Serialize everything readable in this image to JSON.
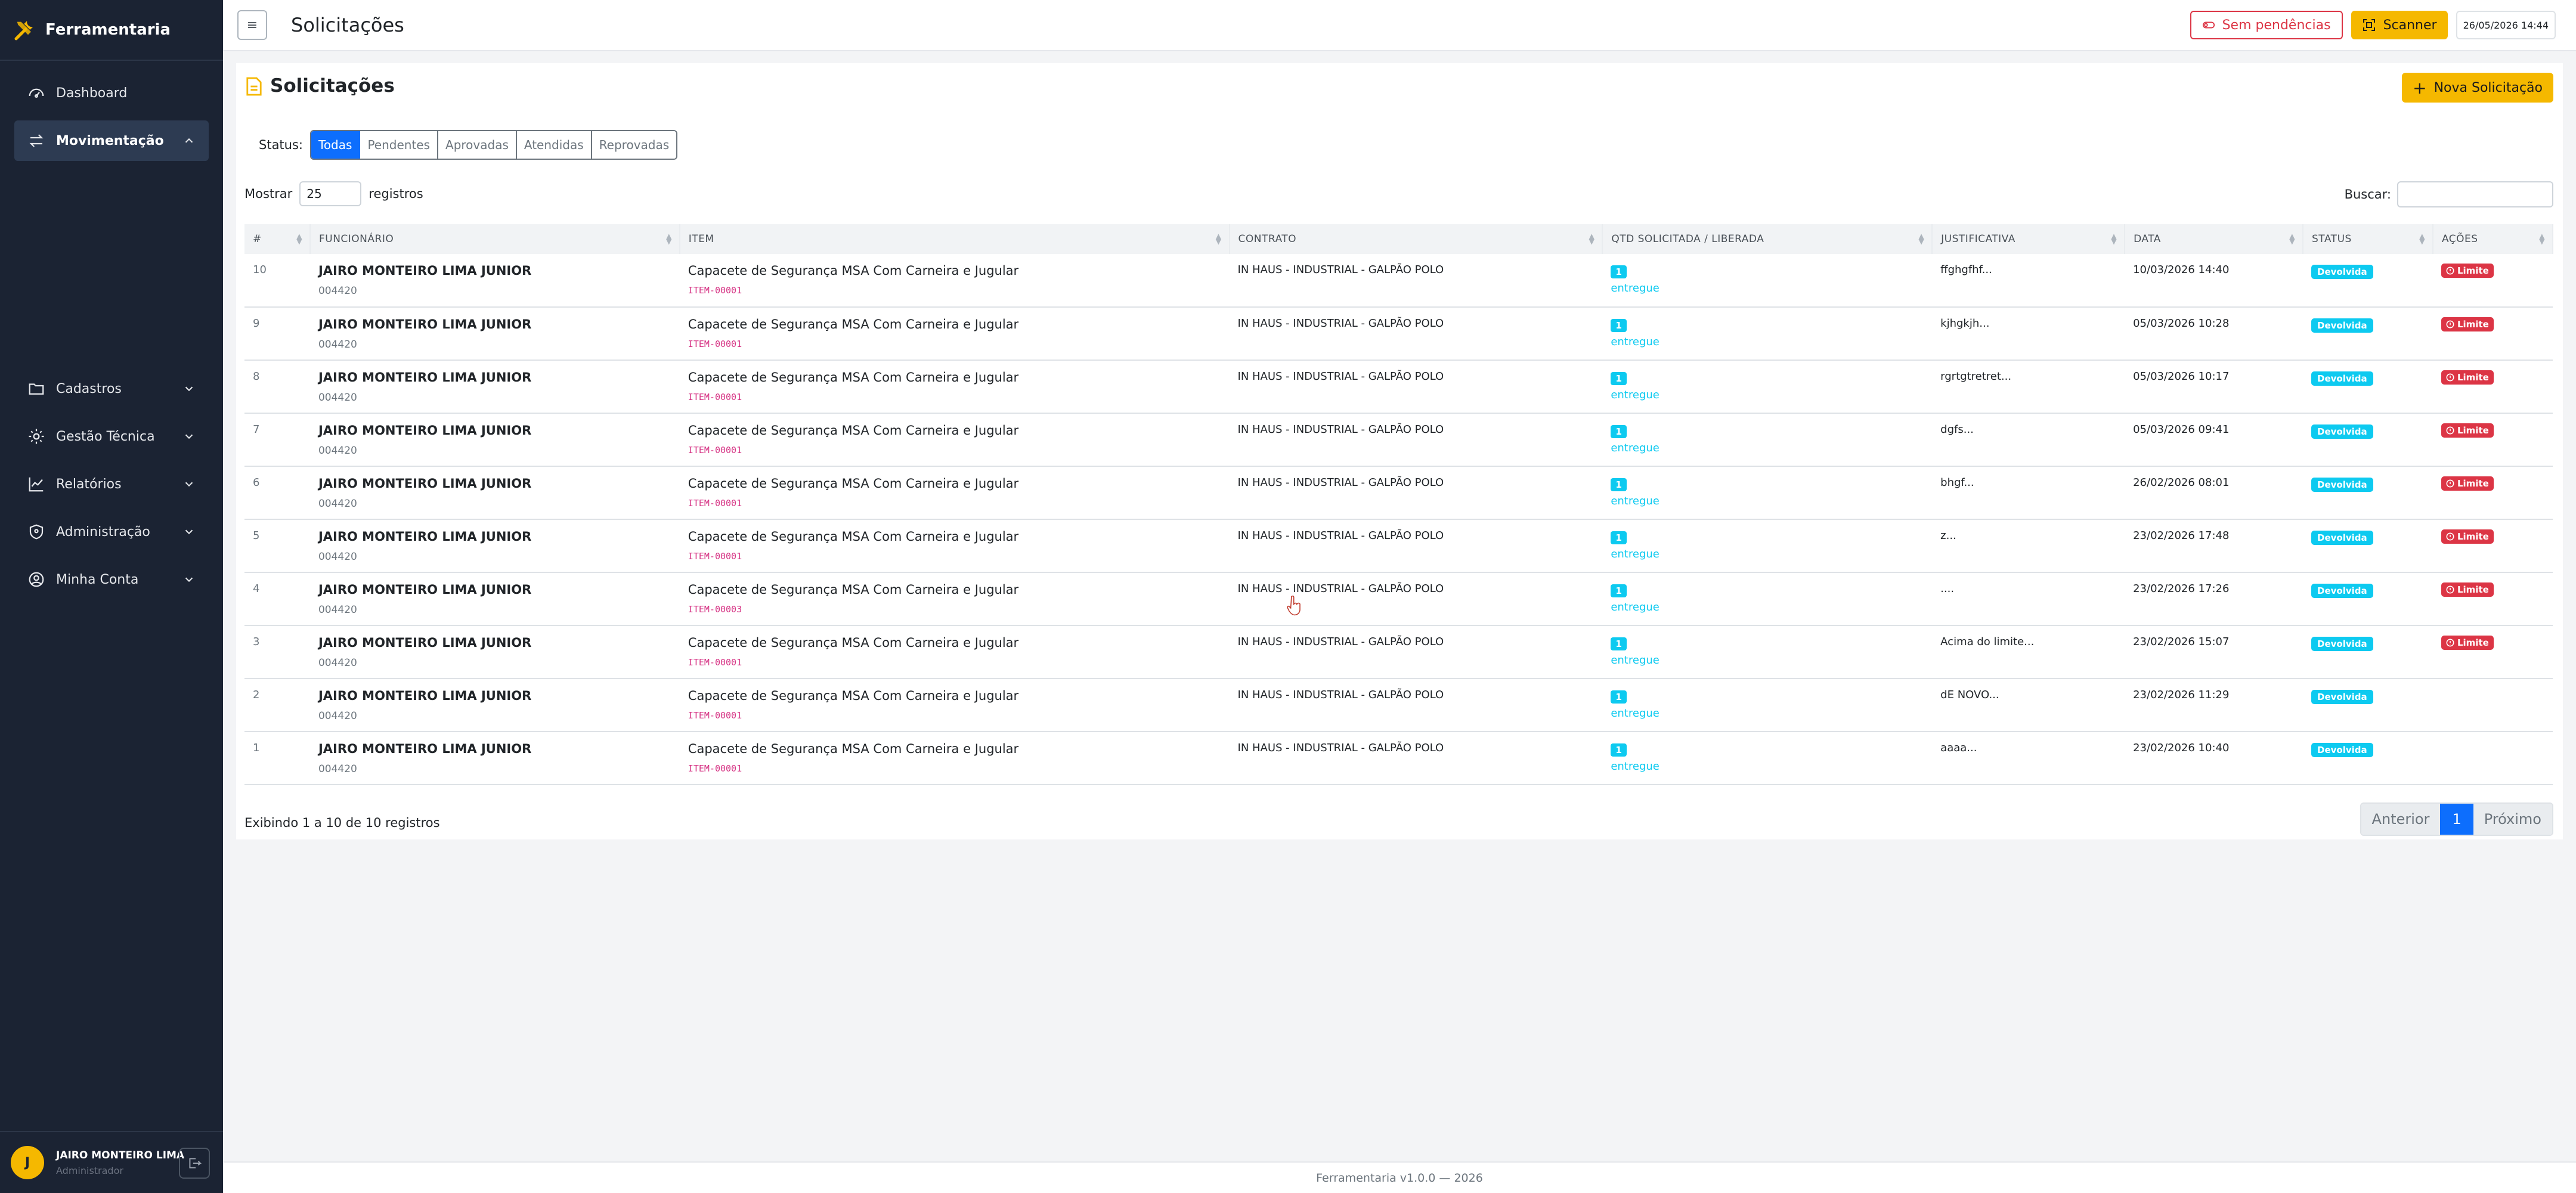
{
  "app": {
    "name": "Ferramentaria"
  },
  "sidebar": {
    "items": [
      {
        "label": "Dashboard",
        "icon": "gauge-icon"
      },
      {
        "label": "Movimentação",
        "icon": "arrows-exchange-icon",
        "active": true
      }
    ],
    "groups": [
      {
        "label": "Cadastros",
        "icon": "folder-icon"
      },
      {
        "label": "Gestão Técnica",
        "icon": "gear-icon"
      },
      {
        "label": "Relatórios",
        "icon": "chart-line-icon"
      },
      {
        "label": "Administração",
        "icon": "shield-icon"
      },
      {
        "label": "Minha Conta",
        "icon": "user-circle-icon"
      }
    ],
    "user": {
      "initial": "J",
      "name": "JAIRO MONTEIRO LIMA",
      "role": "Administrador"
    }
  },
  "topbar": {
    "title": "Solicitações",
    "pending_label": "Sem pendências",
    "scanner_label": "Scanner",
    "datetime": "26/05/2026 14:44"
  },
  "card": {
    "title": "Solicitações",
    "new_button": "Nova Solicitação",
    "status_label": "Status:",
    "filters": [
      "Todas",
      "Pendentes",
      "Aprovadas",
      "Atendidas",
      "Reprovadas"
    ],
    "show_label": "Mostrar",
    "show_value": "25",
    "records_label": "registros",
    "search_label": "Buscar:",
    "info": "Exibindo 1 a 10 de 10 registros",
    "pager": {
      "prev": "Anterior",
      "current": "1",
      "next": "Próximo"
    }
  },
  "table": {
    "columns": [
      "#",
      "FUNCIONÁRIO",
      "ITEM",
      "CONTRATO",
      "QTD SOLICITADA / LIBERADA",
      "JUSTIFICATIVA",
      "DATA",
      "STATUS",
      "AÇÕES"
    ],
    "rows": [
      {
        "id": "10",
        "name": "JAIRO MONTEIRO LIMA JUNIOR",
        "code": "004420",
        "item": "Capacete de Segurança MSA Com Carneira e Jugular",
        "item_code": "ITEM-00001",
        "contract": "IN HAUS - INDUSTRIAL - GALPÃO POLO",
        "qty": "1",
        "qty_status": "entregue",
        "just": "ffghgfhf...",
        "date": "10/03/2026 14:40",
        "status": "Devolvida",
        "action": "Limite"
      },
      {
        "id": "9",
        "name": "JAIRO MONTEIRO LIMA JUNIOR",
        "code": "004420",
        "item": "Capacete de Segurança MSA Com Carneira e Jugular",
        "item_code": "ITEM-00001",
        "contract": "IN HAUS - INDUSTRIAL - GALPÃO POLO",
        "qty": "1",
        "qty_status": "entregue",
        "just": "kjhgkjh...",
        "date": "05/03/2026 10:28",
        "status": "Devolvida",
        "action": "Limite"
      },
      {
        "id": "8",
        "name": "JAIRO MONTEIRO LIMA JUNIOR",
        "code": "004420",
        "item": "Capacete de Segurança MSA Com Carneira e Jugular",
        "item_code": "ITEM-00001",
        "contract": "IN HAUS - INDUSTRIAL - GALPÃO POLO",
        "qty": "1",
        "qty_status": "entregue",
        "just": "rgrtgtretret...",
        "date": "05/03/2026 10:17",
        "status": "Devolvida",
        "action": "Limite"
      },
      {
        "id": "7",
        "name": "JAIRO MONTEIRO LIMA JUNIOR",
        "code": "004420",
        "item": "Capacete de Segurança MSA Com Carneira e Jugular",
        "item_code": "ITEM-00001",
        "contract": "IN HAUS - INDUSTRIAL - GALPÃO POLO",
        "qty": "1",
        "qty_status": "entregue",
        "just": "dgfs...",
        "date": "05/03/2026 09:41",
        "status": "Devolvida",
        "action": "Limite"
      },
      {
        "id": "6",
        "name": "JAIRO MONTEIRO LIMA JUNIOR",
        "code": "004420",
        "item": "Capacete de Segurança MSA Com Carneira e Jugular",
        "item_code": "ITEM-00001",
        "contract": "IN HAUS - INDUSTRIAL - GALPÃO POLO",
        "qty": "1",
        "qty_status": "entregue",
        "just": "bhgf...",
        "date": "26/02/2026 08:01",
        "status": "Devolvida",
        "action": "Limite"
      },
      {
        "id": "5",
        "name": "JAIRO MONTEIRO LIMA JUNIOR",
        "code": "004420",
        "item": "Capacete de Segurança MSA Com Carneira e Jugular",
        "item_code": "ITEM-00001",
        "contract": "IN HAUS - INDUSTRIAL - GALPÃO POLO",
        "qty": "1",
        "qty_status": "entregue",
        "just": "z...",
        "date": "23/02/2026 17:48",
        "status": "Devolvida",
        "action": "Limite"
      },
      {
        "id": "4",
        "name": "JAIRO MONTEIRO LIMA JUNIOR",
        "code": "004420",
        "item": "Capacete de Segurança MSA Com Carneira e Jugular",
        "item_code": "ITEM-00003",
        "contract": "IN HAUS - INDUSTRIAL - GALPÃO POLO",
        "qty": "1",
        "qty_status": "entregue",
        "just": "....",
        "date": "23/02/2026 17:26",
        "status": "Devolvida",
        "action": "Limite"
      },
      {
        "id": "3",
        "name": "JAIRO MONTEIRO LIMA JUNIOR",
        "code": "004420",
        "item": "Capacete de Segurança MSA Com Carneira e Jugular",
        "item_code": "ITEM-00001",
        "contract": "IN HAUS - INDUSTRIAL - GALPÃO POLO",
        "qty": "1",
        "qty_status": "entregue",
        "just": "Acima do limite...",
        "date": "23/02/2026 15:07",
        "status": "Devolvida",
        "action": "Limite"
      },
      {
        "id": "2",
        "name": "JAIRO MONTEIRO LIMA JUNIOR",
        "code": "004420",
        "item": "Capacete de Segurança MSA Com Carneira e Jugular",
        "item_code": "ITEM-00001",
        "contract": "IN HAUS - INDUSTRIAL - GALPÃO POLO",
        "qty": "1",
        "qty_status": "entregue",
        "just": "dE NOVO...",
        "date": "23/02/2026 11:29",
        "status": "Devolvida",
        "action": ""
      },
      {
        "id": "1",
        "name": "JAIRO MONTEIRO LIMA JUNIOR",
        "code": "004420",
        "item": "Capacete de Segurança MSA Com Carneira e Jugular",
        "item_code": "ITEM-00001",
        "contract": "IN HAUS - INDUSTRIAL - GALPÃO POLO",
        "qty": "1",
        "qty_status": "entregue",
        "just": "aaaa...",
        "date": "23/02/2026 10:40",
        "status": "Devolvida",
        "action": ""
      }
    ]
  },
  "footer": {
    "text": "Ferramentaria v1.0.0 — 2026"
  },
  "colors": {
    "sidebar": "#1b2333",
    "accent": "#f5b800",
    "primary": "#0d6efd",
    "info": "#0dcaf0",
    "danger": "#dc3545"
  }
}
